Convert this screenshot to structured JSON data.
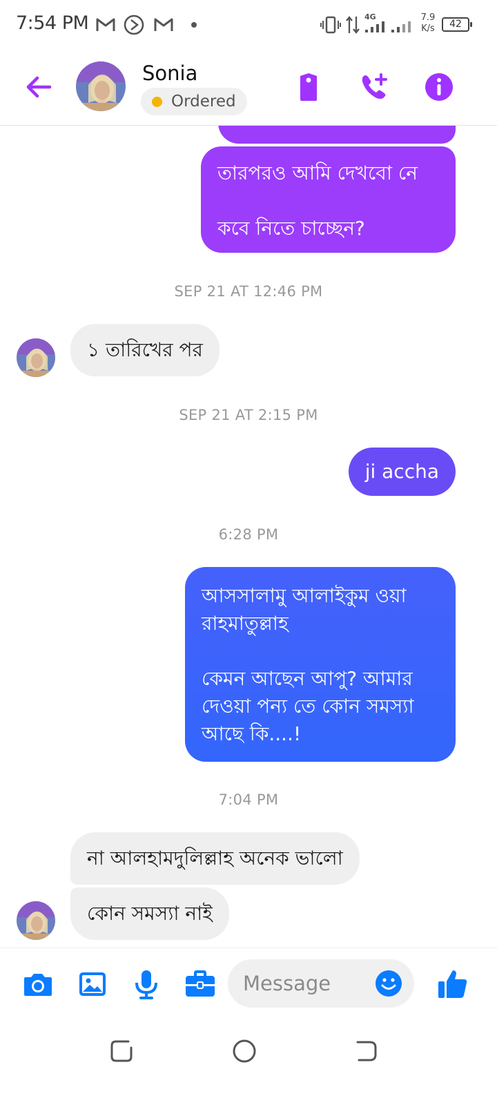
{
  "status_bar": {
    "time": "7:54 PM",
    "network_type": "4G",
    "speed_value": "7.9",
    "speed_unit": "K/s",
    "battery": "42",
    "icons": [
      "gmail-icon",
      "sync-icon",
      "gmail-icon",
      "dot-icon",
      "vibrate-icon",
      "data-arrows-icon",
      "signal-icon",
      "signal-icon",
      "battery-icon"
    ]
  },
  "header": {
    "contact_name": "Sonia",
    "status_label": "Ordered",
    "status_color": "#f5b400",
    "accent_color": "#a033ff",
    "icons": [
      "back-arrow-icon",
      "tag-icon",
      "add-call-icon",
      "info-icon"
    ]
  },
  "messages": [
    {
      "type": "outgoing",
      "text": "তারপরও আমি দেখবো নে\n\nকবে নিতে চাচ্ছেন?",
      "color": "#9b3dfb"
    },
    {
      "type": "timestamp",
      "text": "SEP 21 AT 12:46 PM"
    },
    {
      "type": "incoming",
      "text": "১ তারিখের পর"
    },
    {
      "type": "timestamp",
      "text": "SEP 21 AT 2:15 PM"
    },
    {
      "type": "outgoing",
      "text": "ji accha",
      "color": "#6a4cf7"
    },
    {
      "type": "timestamp",
      "text": "6:28 PM"
    },
    {
      "type": "outgoing",
      "text": "আসসালামু আলাইকুম ওয়া রাহমাতুল্লাহ\n\nকেমন আছেন আপু? আমার দেওয়া পন্য তে কোন সমস্যা আছে কি....!",
      "color": "#3d63fb"
    },
    {
      "type": "timestamp",
      "text": "7:04 PM"
    },
    {
      "type": "incoming",
      "text": "না আলহামদুলিল্লাহ অনেক ভালো"
    },
    {
      "type": "incoming",
      "text": "কোন সমস্যা নাই"
    }
  ],
  "composer": {
    "placeholder": "Message",
    "icon_color": "#0a7cff",
    "icons": [
      "camera-icon",
      "gallery-icon",
      "microphone-icon",
      "briefcase-icon",
      "emoji-icon",
      "thumbs-up-icon"
    ]
  },
  "nav_bar": {
    "icons": [
      "recents-icon",
      "home-icon",
      "back-icon"
    ]
  }
}
